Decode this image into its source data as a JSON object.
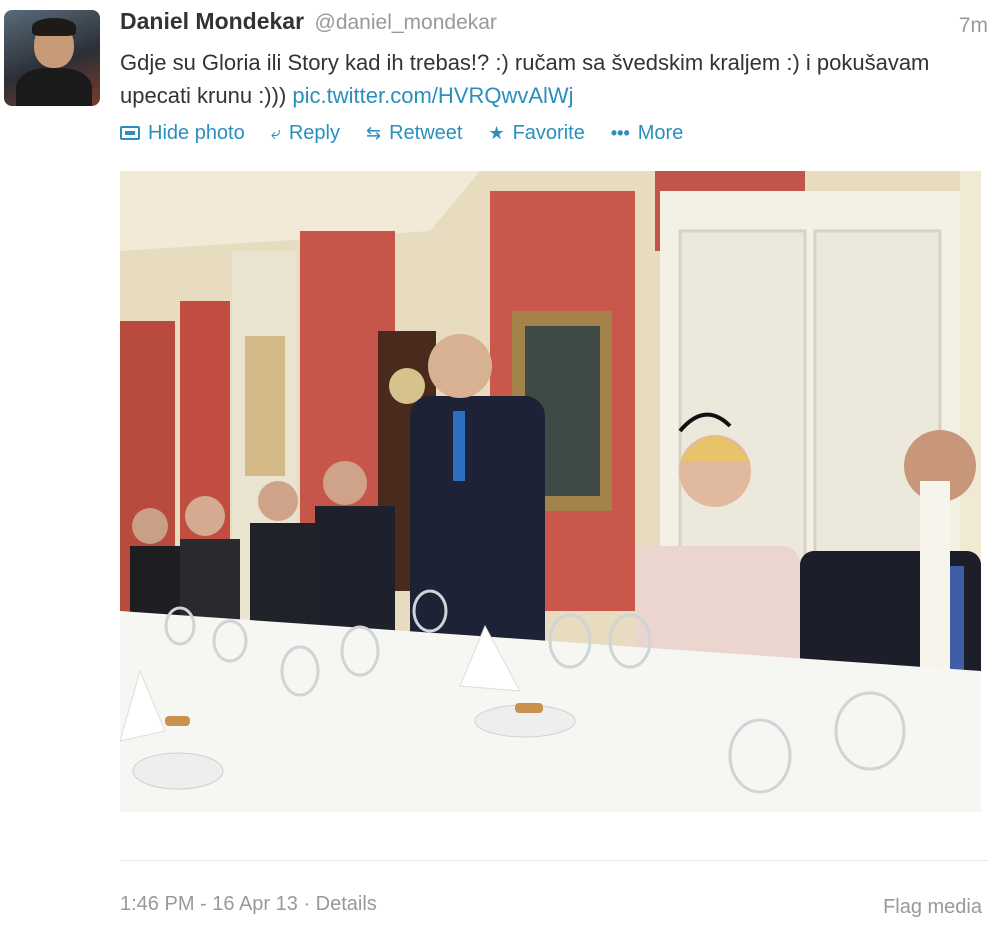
{
  "user": {
    "fullname": "Daniel Mondekar",
    "username": "@daniel_mondekar",
    "time_ago": "7m"
  },
  "tweet": {
    "text": "Gdje su Gloria ili Story kad ih trebas!? :) ručam sa švedskim kraljem :) i pokušavam upecati krunu :))) ",
    "link": "pic.twitter.com/HVRQwvAlWj"
  },
  "actions": {
    "hide_photo": "Hide photo",
    "reply": "Reply",
    "retweet": "Retweet",
    "favorite": "Favorite",
    "more": "More"
  },
  "footer": {
    "timestamp": "1:46 PM - 16 Apr 13",
    "separator": " · ",
    "details": "Details",
    "flag_media": "Flag media"
  },
  "colors": {
    "link": "#2a8fbd",
    "muted": "#999999"
  }
}
